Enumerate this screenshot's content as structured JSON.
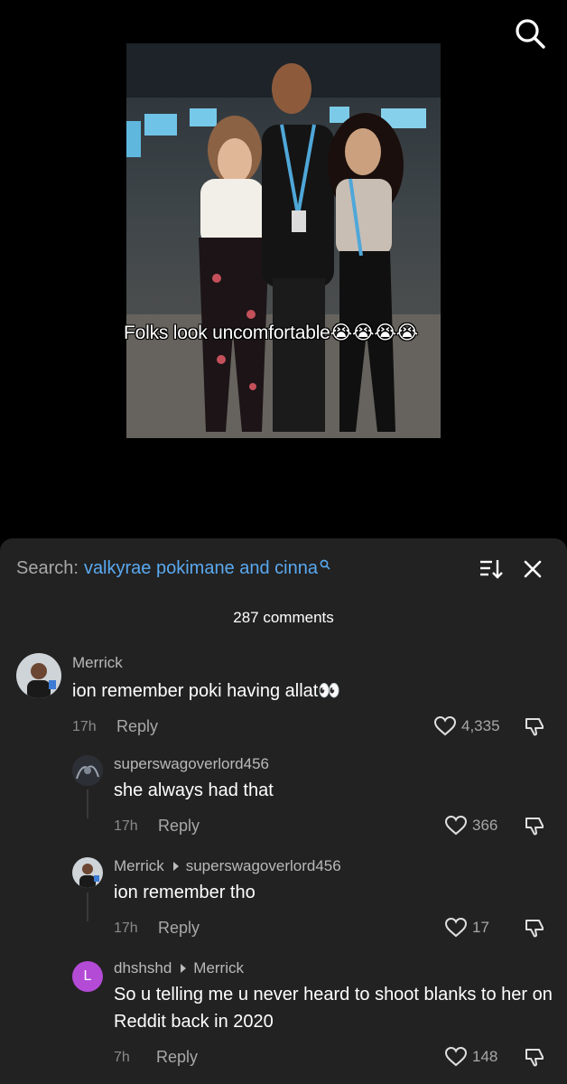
{
  "video": {
    "caption": "Folks look uncomfortable😭😭😭😭"
  },
  "top_bar": {
    "search_icon": "search-icon"
  },
  "comments_sheet": {
    "search_label": "Search:",
    "search_term": "valkyrae pokimane and cinna",
    "comment_count": "287 comments",
    "comments": [
      {
        "username": "Merrick",
        "text": "ion remember poki having allat👀",
        "time": "17h",
        "reply_label": "Reply",
        "likes": "4,335"
      },
      {
        "username": "superswagoverlord456",
        "text": "she always had that",
        "time": "17h",
        "reply_label": "Reply",
        "likes": "366"
      },
      {
        "username": "Merrick",
        "reply_to": "superswagoverlord456",
        "text": "ion remember tho",
        "time": "17h",
        "reply_label": "Reply",
        "likes": "17"
      },
      {
        "username": "dhshshd",
        "avatar_letter": "L",
        "reply_to": "Merrick",
        "text": "So u telling me u never heard to shoot blanks to her on Reddit back in 2020",
        "time": "7h",
        "reply_label": "Reply",
        "likes": "148"
      }
    ]
  },
  "colors": {
    "sheet_bg": "#222222",
    "search_term": "#5aa9f0",
    "avatar_purple": "#b44bd6"
  }
}
